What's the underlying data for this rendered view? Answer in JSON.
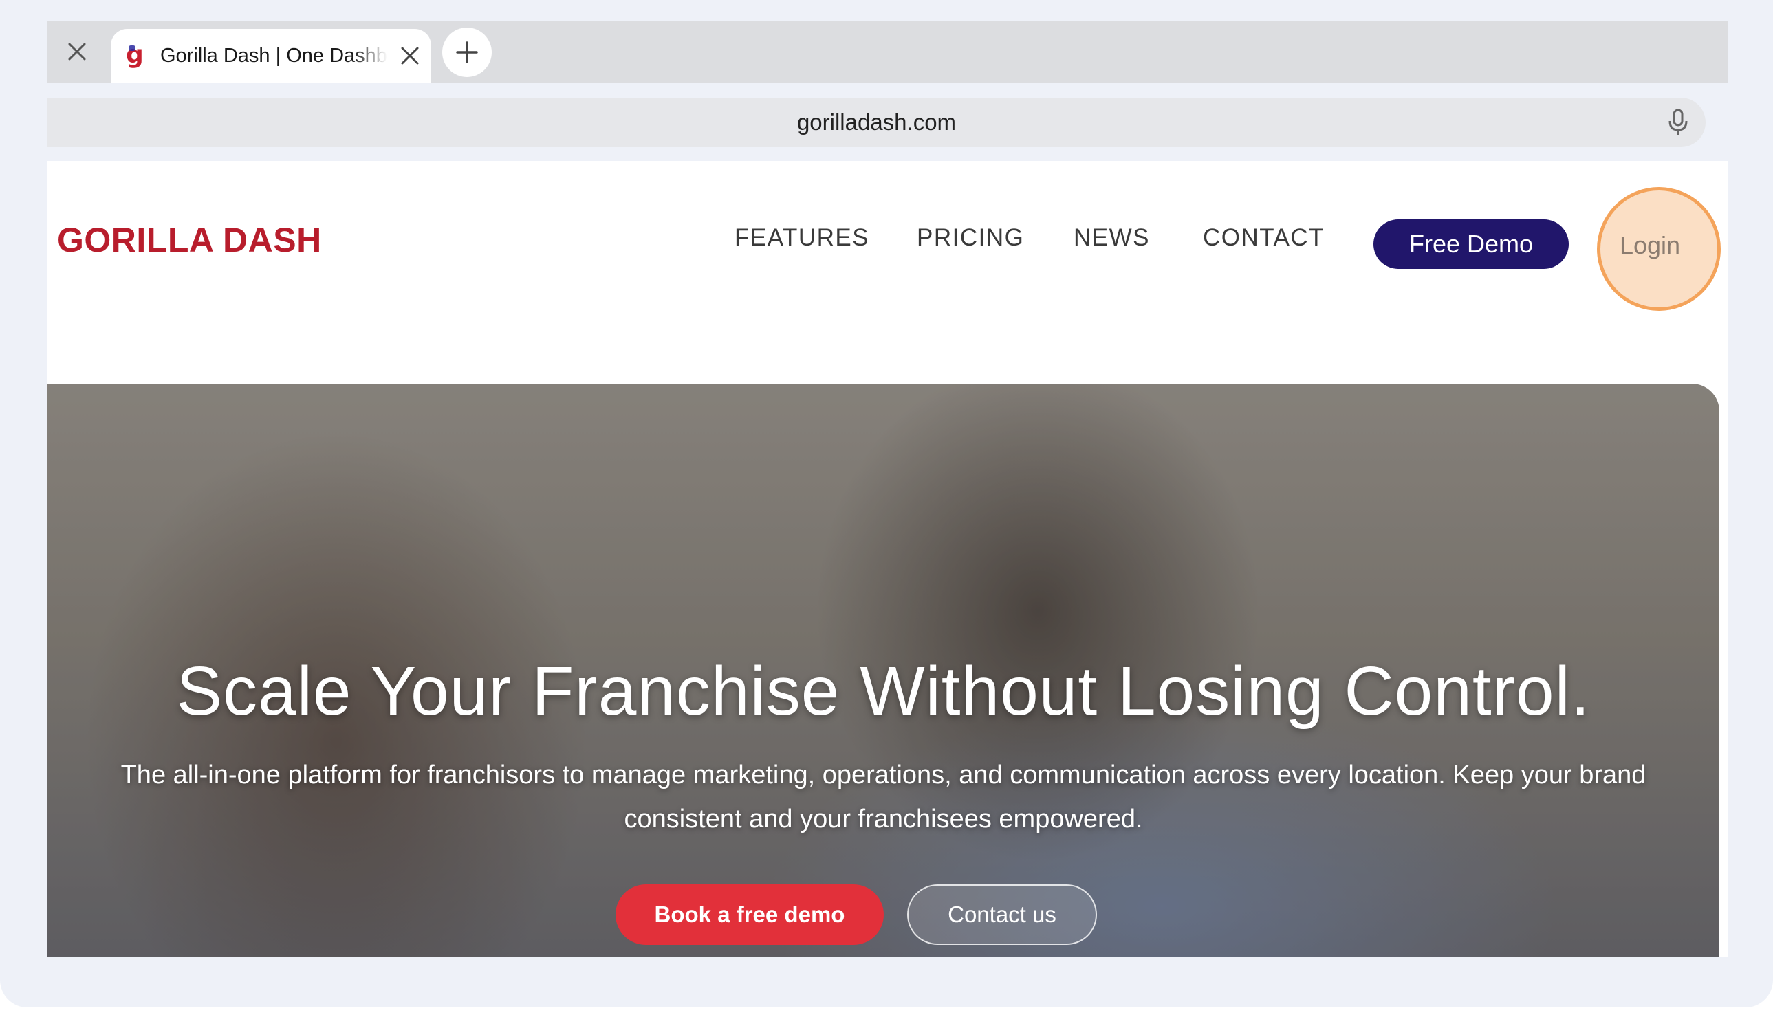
{
  "browser": {
    "tab": {
      "title": "Gorilla Dash | One Dashboard"
    },
    "address": {
      "url": "gorilladash.com"
    }
  },
  "site": {
    "logo": "GORILLA DASH",
    "nav": [
      "FEATURES",
      "PRICING",
      "NEWS",
      "CONTACT"
    ],
    "free_demo_label": "Free Demo",
    "login_label": "Login"
  },
  "hero": {
    "title": "Scale Your Franchise Without Losing Control.",
    "subtitle": "The all-in-one platform for franchisors to manage marketing, operations, and communication across every location. Keep your brand consistent and your franchisees empowered.",
    "primary_cta": "Book a free demo",
    "secondary_cta": "Contact us"
  },
  "colors": {
    "brand_red": "#b81d2c",
    "demo_button": "#21166b",
    "cta_red": "#e2303a",
    "highlight_ring": "#f4a35a"
  },
  "icons": {
    "window_close": "close-icon",
    "tab_close": "close-icon",
    "new_tab": "plus-icon",
    "voice": "microphone-icon",
    "favicon": "gorilla-dash-favicon"
  }
}
